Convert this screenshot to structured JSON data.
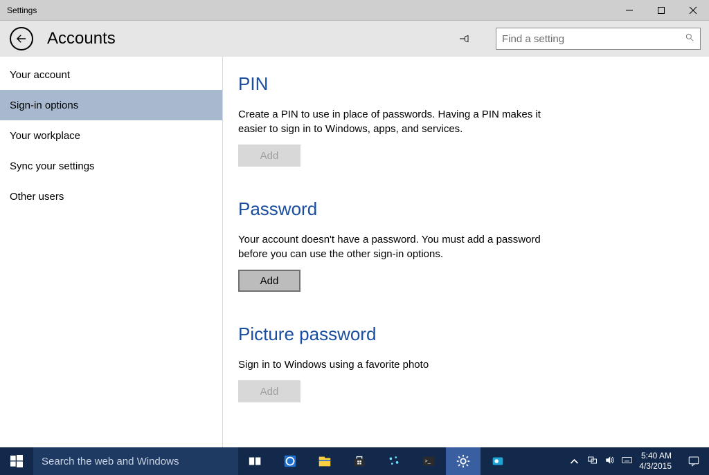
{
  "titlebar": {
    "title": "Settings"
  },
  "header": {
    "page_title": "Accounts",
    "search_placeholder": "Find a setting"
  },
  "sidebar": {
    "items": [
      {
        "label": "Your account",
        "selected": false
      },
      {
        "label": "Sign-in options",
        "selected": true
      },
      {
        "label": "Your workplace",
        "selected": false
      },
      {
        "label": "Sync your settings",
        "selected": false
      },
      {
        "label": "Other users",
        "selected": false
      }
    ]
  },
  "content": {
    "pin": {
      "heading": "PIN",
      "desc": "Create a PIN to use in place of passwords. Having a PIN makes it easier to sign in to Windows, apps, and services.",
      "button": "Add",
      "enabled": false
    },
    "password": {
      "heading": "Password",
      "desc": "Your account doesn't have a password. You must add a password before you can use the other sign-in options.",
      "button": "Add",
      "enabled": true
    },
    "picture": {
      "heading": "Picture password",
      "desc": "Sign in to Windows using a favorite photo",
      "button": "Add",
      "enabled": false
    }
  },
  "taskbar": {
    "search_placeholder": "Search the web and Windows",
    "time": "5:40 AM",
    "date": "4/3/2015"
  }
}
